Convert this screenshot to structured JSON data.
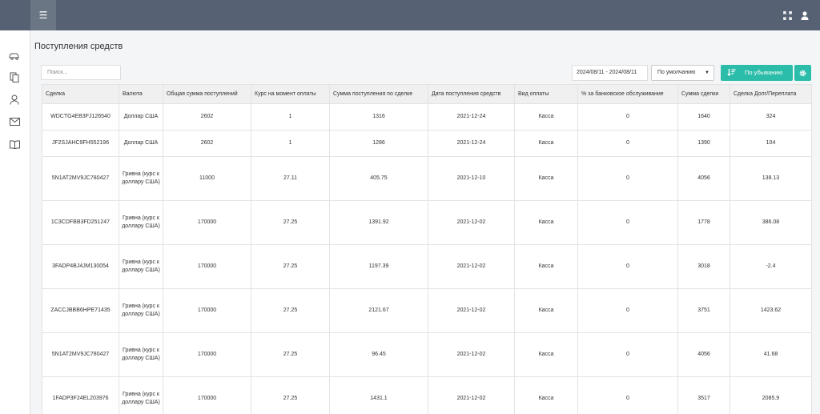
{
  "header": {},
  "page": {
    "title": "Поступления средств"
  },
  "toolbar": {
    "search_placeholder": "Поиск...",
    "date_range": "2024/08/11 - 2024/08/11",
    "sort_select": "По умолчанию",
    "sort_button": "По убыванию"
  },
  "colors": {
    "topbar": "#566273",
    "accent": "#2cbdaa",
    "negative": "#e8414a"
  },
  "table": {
    "columns": [
      "Сделка",
      "Валюта",
      "Общая сумма поступлений",
      "Курс на момент оплаты",
      "Сумма поступления по сделке",
      "Дата поступления средств",
      "Вид оплаты",
      "% за банковское обслуживание",
      "Сумма сделки",
      "Сделка Долг/Переплата"
    ],
    "rows": [
      {
        "deal": "WDCTG4EB3FJ126540",
        "currency": "Доллар США",
        "total": "2602",
        "rate": "1",
        "amount": "1316",
        "date": "2021-12-24",
        "pay_type": "Касса",
        "bank_pct": "0",
        "deal_sum": "1640",
        "balance": "324",
        "balance_color": "neg"
      },
      {
        "deal": "JF2SJAHC9FH552196",
        "currency": "Доллар США",
        "total": "2602",
        "rate": "1",
        "amount": "1286",
        "date": "2021-12-24",
        "pay_type": "Касса",
        "bank_pct": "0",
        "deal_sum": "1390",
        "balance": "104",
        "balance_color": "neg"
      },
      {
        "deal": "5N1AT2MV9JC780427",
        "currency": "Гривна (курс к доллару США)",
        "total": "11000",
        "rate": "27.11",
        "amount": "405.75",
        "date": "2021-12-10",
        "pay_type": "Касса",
        "bank_pct": "0",
        "deal_sum": "4056",
        "balance": "138.13",
        "balance_color": "neg"
      },
      {
        "deal": "1C3CDFBB3FD251247",
        "currency": "Гривна (курс к доллару США)",
        "total": "170000",
        "rate": "27.25",
        "amount": "1391.92",
        "date": "2021-12-02",
        "pay_type": "Касса",
        "bank_pct": "0",
        "deal_sum": "1778",
        "balance": "386.08",
        "balance_color": "neg"
      },
      {
        "deal": "3FADP4BJ4JM130054",
        "currency": "Гривна (курс к доллару США)",
        "total": "170000",
        "rate": "27.25",
        "amount": "1197.39",
        "date": "2021-12-02",
        "pay_type": "Касса",
        "bank_pct": "0",
        "deal_sum": "3018",
        "balance": "-2.4",
        "balance_color": "pos"
      },
      {
        "deal": "ZACCJBBB6HPE71435",
        "currency": "Гривна (курс к доллару США)",
        "total": "170000",
        "rate": "27.25",
        "amount": "2121.67",
        "date": "2021-12-02",
        "pay_type": "Касса",
        "bank_pct": "0",
        "deal_sum": "3751",
        "balance": "1423.62",
        "balance_color": "neg"
      },
      {
        "deal": "5N1AT2MV9JC780427",
        "currency": "Гривна (курс к доллару США)",
        "total": "170000",
        "rate": "27.25",
        "amount": "96.45",
        "date": "2021-12-02",
        "pay_type": "Касса",
        "bank_pct": "0",
        "deal_sum": "4056",
        "balance": "41.68",
        "balance_color": "neg"
      },
      {
        "deal": "1FADP3F24EL203976",
        "currency": "Гривна (курс к доллару США)",
        "total": "170000",
        "rate": "27.25",
        "amount": "1431.1",
        "date": "2021-12-02",
        "pay_type": "Касса",
        "bank_pct": "0",
        "deal_sum": "3517",
        "balance": "2085.9",
        "balance_color": "neg"
      }
    ]
  },
  "sidebar": {
    "items": [
      {
        "icon": "car-icon"
      },
      {
        "icon": "documents-icon"
      },
      {
        "icon": "user-icon"
      },
      {
        "icon": "mail-icon"
      },
      {
        "icon": "book-icon"
      }
    ]
  }
}
